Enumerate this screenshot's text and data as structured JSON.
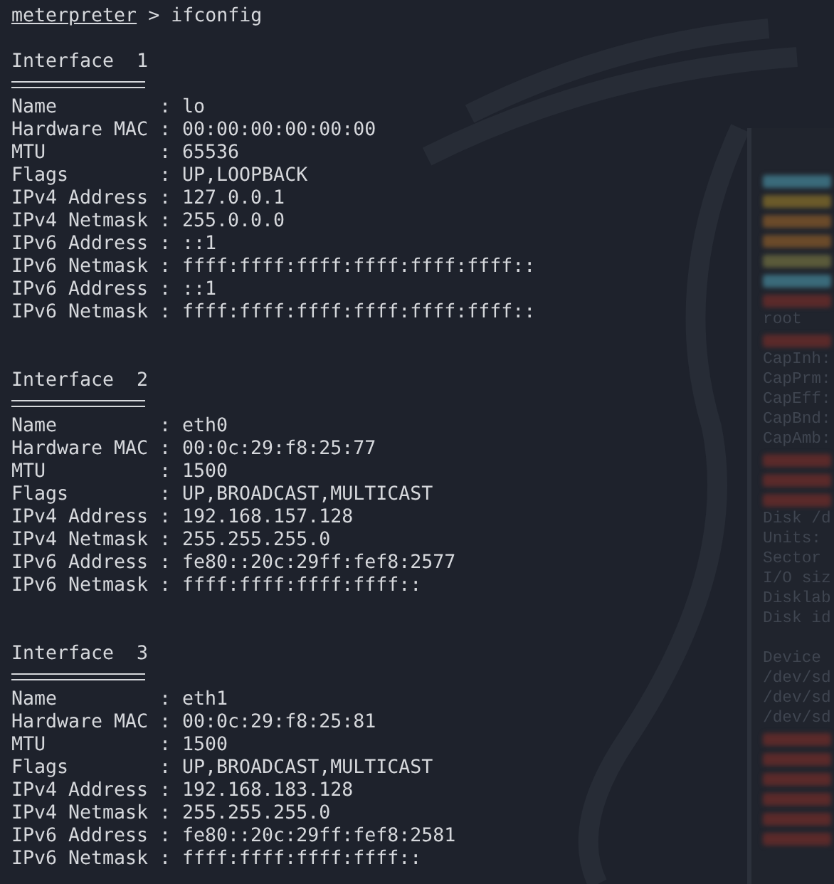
{
  "prompt": {
    "shell": "meterpreter",
    "separator": ">",
    "command": "ifconfig"
  },
  "interfaces": [
    {
      "title": "Interface  1",
      "fields": [
        {
          "label": "Name",
          "separator": ":",
          "value": "lo"
        },
        {
          "label": "Hardware MAC",
          "separator": ":",
          "value": "00:00:00:00:00:00"
        },
        {
          "label": "MTU",
          "separator": ":",
          "value": "65536"
        },
        {
          "label": "Flags",
          "separator": ":",
          "value": "UP,LOOPBACK"
        },
        {
          "label": "IPv4 Address",
          "separator": ":",
          "value": "127.0.0.1"
        },
        {
          "label": "IPv4 Netmask",
          "separator": ":",
          "value": "255.0.0.0"
        },
        {
          "label": "IPv6 Address",
          "separator": ":",
          "value": "::1"
        },
        {
          "label": "IPv6 Netmask",
          "separator": ":",
          "value": "ffff:ffff:ffff:ffff:ffff:ffff::"
        },
        {
          "label": "IPv6 Address",
          "separator": ":",
          "value": "::1"
        },
        {
          "label": "IPv6 Netmask",
          "separator": ":",
          "value": "ffff:ffff:ffff:ffff:ffff:ffff::"
        }
      ]
    },
    {
      "title": "Interface  2",
      "fields": [
        {
          "label": "Name",
          "separator": ":",
          "value": "eth0"
        },
        {
          "label": "Hardware MAC",
          "separator": ":",
          "value": "00:0c:29:f8:25:77"
        },
        {
          "label": "MTU",
          "separator": ":",
          "value": "1500"
        },
        {
          "label": "Flags",
          "separator": ":",
          "value": "UP,BROADCAST,MULTICAST"
        },
        {
          "label": "IPv4 Address",
          "separator": ":",
          "value": "192.168.157.128"
        },
        {
          "label": "IPv4 Netmask",
          "separator": ":",
          "value": "255.255.255.0"
        },
        {
          "label": "IPv6 Address",
          "separator": ":",
          "value": "fe80::20c:29ff:fef8:2577"
        },
        {
          "label": "IPv6 Netmask",
          "separator": ":",
          "value": "ffff:ffff:ffff:ffff::"
        }
      ]
    },
    {
      "title": "Interface  3",
      "fields": [
        {
          "label": "Name",
          "separator": ":",
          "value": "eth1"
        },
        {
          "label": "Hardware MAC",
          "separator": ":",
          "value": "00:0c:29:f8:25:81"
        },
        {
          "label": "MTU",
          "separator": ":",
          "value": "1500"
        },
        {
          "label": "Flags",
          "separator": ":",
          "value": "UP,BROADCAST,MULTICAST"
        },
        {
          "label": "IPv4 Address",
          "separator": ":",
          "value": "192.168.183.128"
        },
        {
          "label": "IPv4 Netmask",
          "separator": ":",
          "value": "255.255.255.0"
        },
        {
          "label": "IPv6 Address",
          "separator": ":",
          "value": "fe80::20c:29ff:fef8:2581"
        },
        {
          "label": "IPv6 Netmask",
          "separator": ":",
          "value": "ffff:ffff:ffff:ffff::"
        }
      ]
    }
  ],
  "background_window": {
    "lines": [
      {
        "kind": "smear",
        "color": "#3a6a7a"
      },
      {
        "kind": "smear",
        "color": "#6a5a2a"
      },
      {
        "kind": "smear",
        "color": "#6a4a2a"
      },
      {
        "kind": "smear",
        "color": "#6a4a2a"
      },
      {
        "kind": "smear",
        "color": "#5a5a3a"
      },
      {
        "kind": "smear",
        "color": "#3a6a7a"
      },
      {
        "kind": "smear",
        "color": "#5a2a2a"
      },
      {
        "kind": "text",
        "text": "root"
      },
      {
        "kind": "smear",
        "color": "#5a2a2a"
      },
      {
        "kind": "text",
        "text": "CapInh:"
      },
      {
        "kind": "text",
        "text": "CapPrm:"
      },
      {
        "kind": "text",
        "text": "CapEff:"
      },
      {
        "kind": "text",
        "text": "CapBnd:"
      },
      {
        "kind": "text",
        "text": "CapAmb:"
      },
      {
        "kind": "smear",
        "color": "#5a2a2a"
      },
      {
        "kind": "smear",
        "color": "#5a2a2a"
      },
      {
        "kind": "smear",
        "color": "#5a2a2a"
      },
      {
        "kind": "text",
        "text": "Disk /d"
      },
      {
        "kind": "text",
        "text": "Units:"
      },
      {
        "kind": "text",
        "text": "Sector"
      },
      {
        "kind": "text",
        "text": "I/O siz"
      },
      {
        "kind": "text",
        "text": "Disklab"
      },
      {
        "kind": "text",
        "text": "Disk id"
      },
      {
        "kind": "blank"
      },
      {
        "kind": "text",
        "text": "Device"
      },
      {
        "kind": "text",
        "text": "/dev/sd"
      },
      {
        "kind": "text",
        "text": "/dev/sd"
      },
      {
        "kind": "text",
        "text": "/dev/sd"
      },
      {
        "kind": "smear",
        "color": "#5a2a2a"
      },
      {
        "kind": "smear",
        "color": "#5a2a2a"
      },
      {
        "kind": "smear",
        "color": "#5a2a2a"
      },
      {
        "kind": "smear",
        "color": "#5a2a2a"
      },
      {
        "kind": "smear",
        "color": "#5a2a2a"
      },
      {
        "kind": "smear",
        "color": "#5a2a2a"
      }
    ]
  }
}
